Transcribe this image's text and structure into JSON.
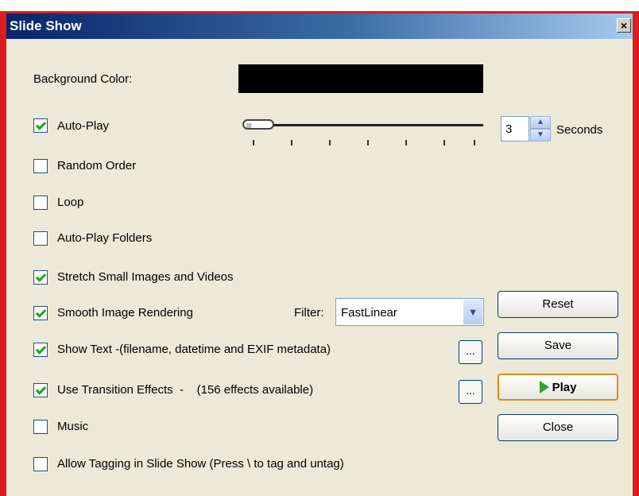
{
  "window": {
    "title": "Slide Show",
    "close_label": "×"
  },
  "background": {
    "label": "Background Color:",
    "color": "#000000"
  },
  "autoplay": {
    "label": "Auto-Play",
    "checked": true,
    "interval_value": "3",
    "interval_unit": "Seconds"
  },
  "options": [
    {
      "label": "Random Order",
      "checked": false
    },
    {
      "label": "Loop",
      "checked": false
    },
    {
      "label": "Auto-Play Folders",
      "checked": false
    },
    {
      "label": "Stretch Small Images and Videos",
      "checked": true
    },
    {
      "label": "Smooth Image Rendering",
      "checked": true
    },
    {
      "label": "Show Text -(filename, datetime and EXIF metadata)",
      "checked": true
    },
    {
      "label": "Use Transition Effects  -    (156 effects available)",
      "checked": true
    },
    {
      "label": "Music",
      "checked": false
    },
    {
      "label": "Allow Tagging in Slide Show (Press \\ to tag and untag)",
      "checked": false
    }
  ],
  "filter": {
    "label": "Filter:",
    "value": "FastLinear"
  },
  "ellipsis_label": "...",
  "buttons": {
    "reset": "Reset",
    "save": "Save",
    "play": "Play",
    "close": "Close"
  },
  "icons": {
    "play": "play-triangle-icon",
    "spin": "spin-arrows-icon",
    "dropdown": "chevron-down-icon"
  }
}
